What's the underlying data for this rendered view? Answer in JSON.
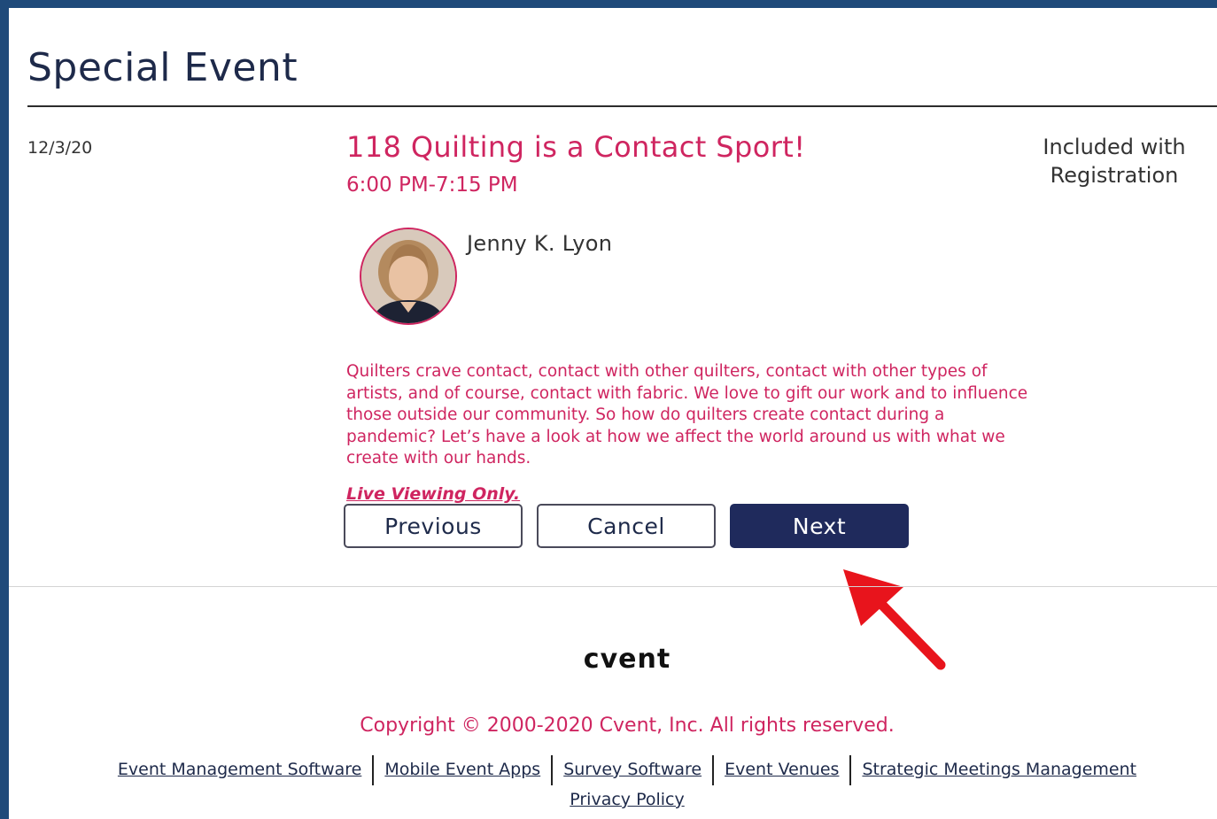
{
  "page": {
    "title": "Special Event"
  },
  "session": {
    "date": "12/3/20",
    "title": "118 Quilting is a Contact Sport!",
    "time": "6:00 PM-7:15 PM",
    "price_line1": "Included with",
    "price_line2": "Registration",
    "speaker": "Jenny K. Lyon",
    "description": "Quilters crave contact, contact with other quilters, contact with other types of artists, and of course, contact with fabric. We love to gift our work and to influence those outside our community. So how do quilters create contact during a pandemic? Let’s have a look at how we affect the world around us with what we create with our hands.",
    "note": "Live Viewing Only."
  },
  "buttons": {
    "previous": "Previous",
    "cancel": "Cancel",
    "next": "Next"
  },
  "footer": {
    "logo": "cvent",
    "copyright": "Copyright © 2000-2020 Cvent, Inc. All rights reserved.",
    "links": [
      "Event Management Software",
      "Mobile Event Apps",
      "Survey Software",
      "Event Venues",
      "Strategic Meetings Management"
    ],
    "privacy": "Privacy Policy"
  },
  "colors": {
    "accent": "#cf2560",
    "primary_button": "#1f2a5c",
    "frame": "#1f4a7a",
    "arrow": "#e8141c"
  }
}
